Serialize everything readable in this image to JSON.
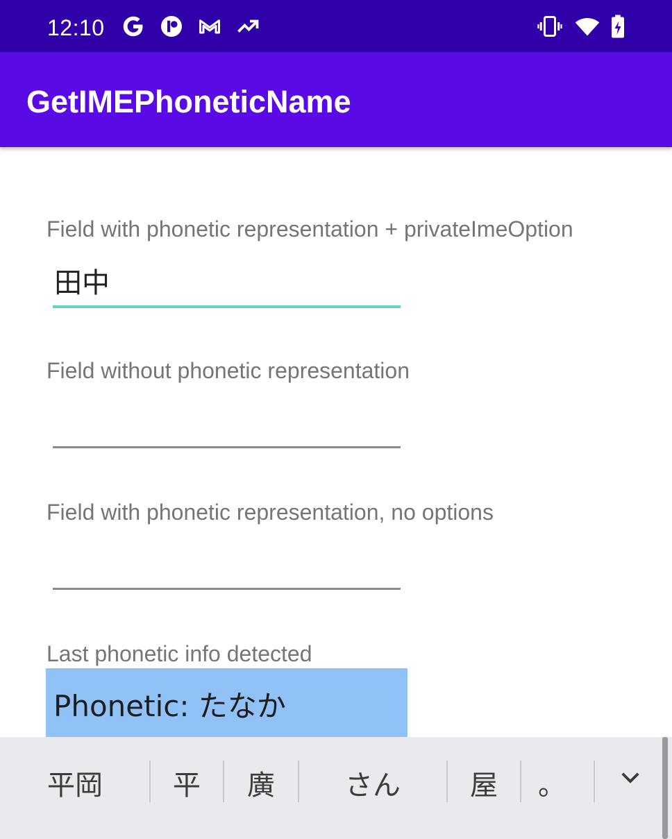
{
  "status_bar": {
    "time": "12:10",
    "left_icons": [
      "google-icon",
      "r-app-icon",
      "gmail-icon",
      "trending-icon"
    ],
    "right_icons": [
      "vibrate-icon",
      "wifi-icon",
      "battery-charging-icon"
    ],
    "background": "#3000A8"
  },
  "app_bar": {
    "title": "GetIMEPhoneticName",
    "background": "#5A0BE5"
  },
  "fields": [
    {
      "label": "Field with phonetic representation + privateImeOption",
      "value": "田中",
      "focused": true
    },
    {
      "label": "Field without phonetic representation",
      "value": "",
      "focused": false
    },
    {
      "label": "Field with phonetic representation, no options",
      "value": "",
      "focused": false
    }
  ],
  "result": {
    "label": "Last phonetic info detected",
    "value": "Phonetic: たなか",
    "background": "#90C2F8"
  },
  "keyboard": {
    "candidates": [
      "平岡",
      "平",
      "廣",
      "さん",
      "屋",
      "。"
    ],
    "expand_icon": "chevron-down-icon",
    "background": "#E8EAED"
  },
  "colors": {
    "accent": "#61D4C4",
    "label_text": "#757575"
  }
}
